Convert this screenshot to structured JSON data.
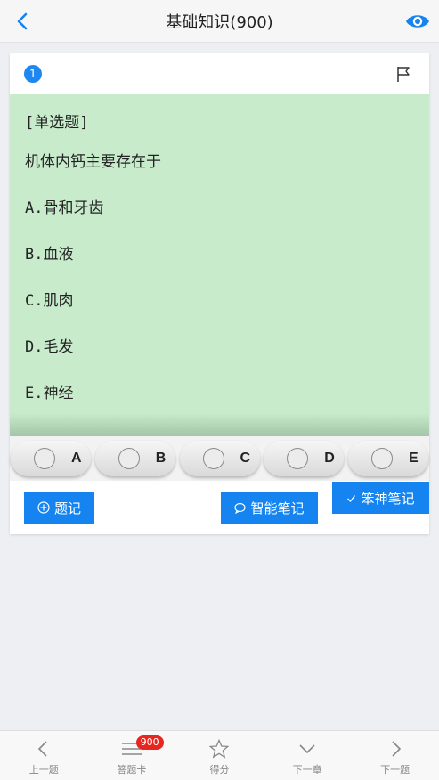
{
  "header": {
    "title": "基础知识(900)"
  },
  "question": {
    "number": "1",
    "type": "[单选题]",
    "text": "机体内钙主要存在于",
    "options": [
      "A.骨和牙齿",
      "B.血液",
      "C.肌肉",
      "D.毛发",
      "E.神经"
    ]
  },
  "answers": [
    "A",
    "B",
    "C",
    "D",
    "E"
  ],
  "notes": {
    "tiji": "题记",
    "zhineng": "智能笔记",
    "benshen": "笨神笔记"
  },
  "tabbar": {
    "prev": "上一题",
    "card": "答题卡",
    "card_count": "900",
    "score": "得分",
    "next_chapter": "下一章",
    "next": "下一题"
  },
  "colors": {
    "accent": "#1684f0",
    "question_bg": "#c7ebcb",
    "badge_red": "#e8251f"
  },
  "icons": {
    "back": "chevron-left-icon",
    "eye": "eye-icon",
    "flag": "flag-icon",
    "plus": "plus-circle-icon",
    "chat": "chat-bubble-icon",
    "check": "check-icon",
    "menu": "menu-icon",
    "star": "star-icon",
    "down": "chevron-down-icon",
    "right": "chevron-right-icon"
  }
}
